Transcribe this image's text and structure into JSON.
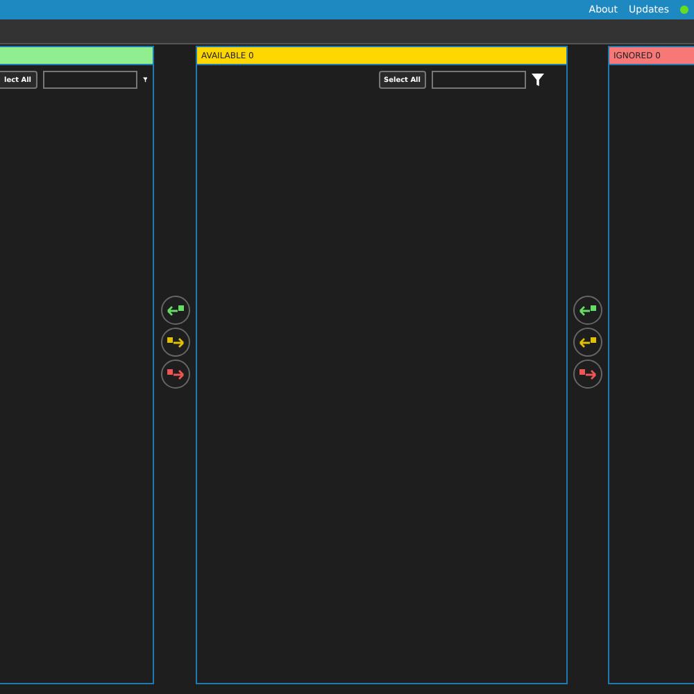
{
  "top_bar": {
    "links": [
      "About",
      "Updates"
    ]
  },
  "panels": [
    {
      "color": "#90ee90",
      "select_all": "lect All"
    },
    {
      "color": "#ffd700",
      "title": "AVAILABLE 0",
      "select_all": "Select All"
    },
    {
      "color": "#f87878",
      "title": "IGNORED 0"
    }
  ],
  "transfer_groups": [
    {
      "buttons": [
        {
          "kind": "left",
          "color": "#66dd66"
        },
        {
          "kind": "right",
          "color": "#e0c000"
        },
        {
          "kind": "right",
          "color": "#ee5555"
        }
      ]
    },
    {
      "buttons": [
        {
          "kind": "left",
          "color": "#66dd66"
        },
        {
          "kind": "left",
          "color": "#e0c000"
        },
        {
          "kind": "right",
          "color": "#ee5555"
        }
      ]
    }
  ]
}
